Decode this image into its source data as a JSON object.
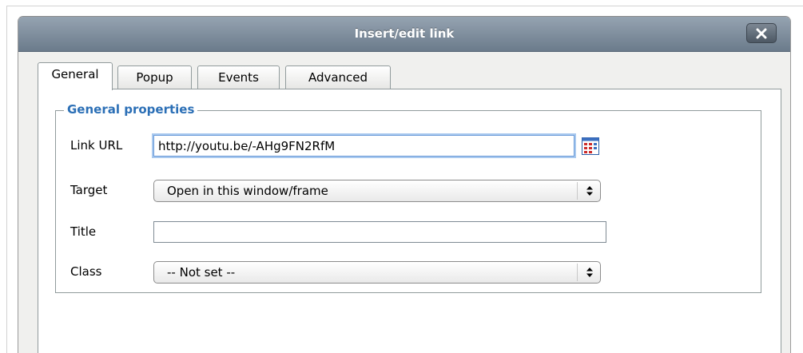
{
  "dialog": {
    "title": "Insert/edit link",
    "close_icon": "close-x-icon"
  },
  "tabs": [
    {
      "label": "General",
      "active": true
    },
    {
      "label": "Popup",
      "active": false
    },
    {
      "label": "Events",
      "active": false
    },
    {
      "label": "Advanced",
      "active": false
    }
  ],
  "general_properties": {
    "legend": "General properties",
    "link_url": {
      "label": "Link URL",
      "value": "http://youtu.be/-AHg9FN2RfM",
      "browse_icon": "link-list-picker-icon"
    },
    "target": {
      "label": "Target",
      "selected": "Open in this window/frame"
    },
    "title": {
      "label": "Title",
      "value": ""
    },
    "class": {
      "label": "Class",
      "selected": "-- Not set --"
    }
  },
  "colors": {
    "legend": "#2b6fb6",
    "titlebar": "#7f8e9d",
    "focus": "#a9c9ef"
  }
}
